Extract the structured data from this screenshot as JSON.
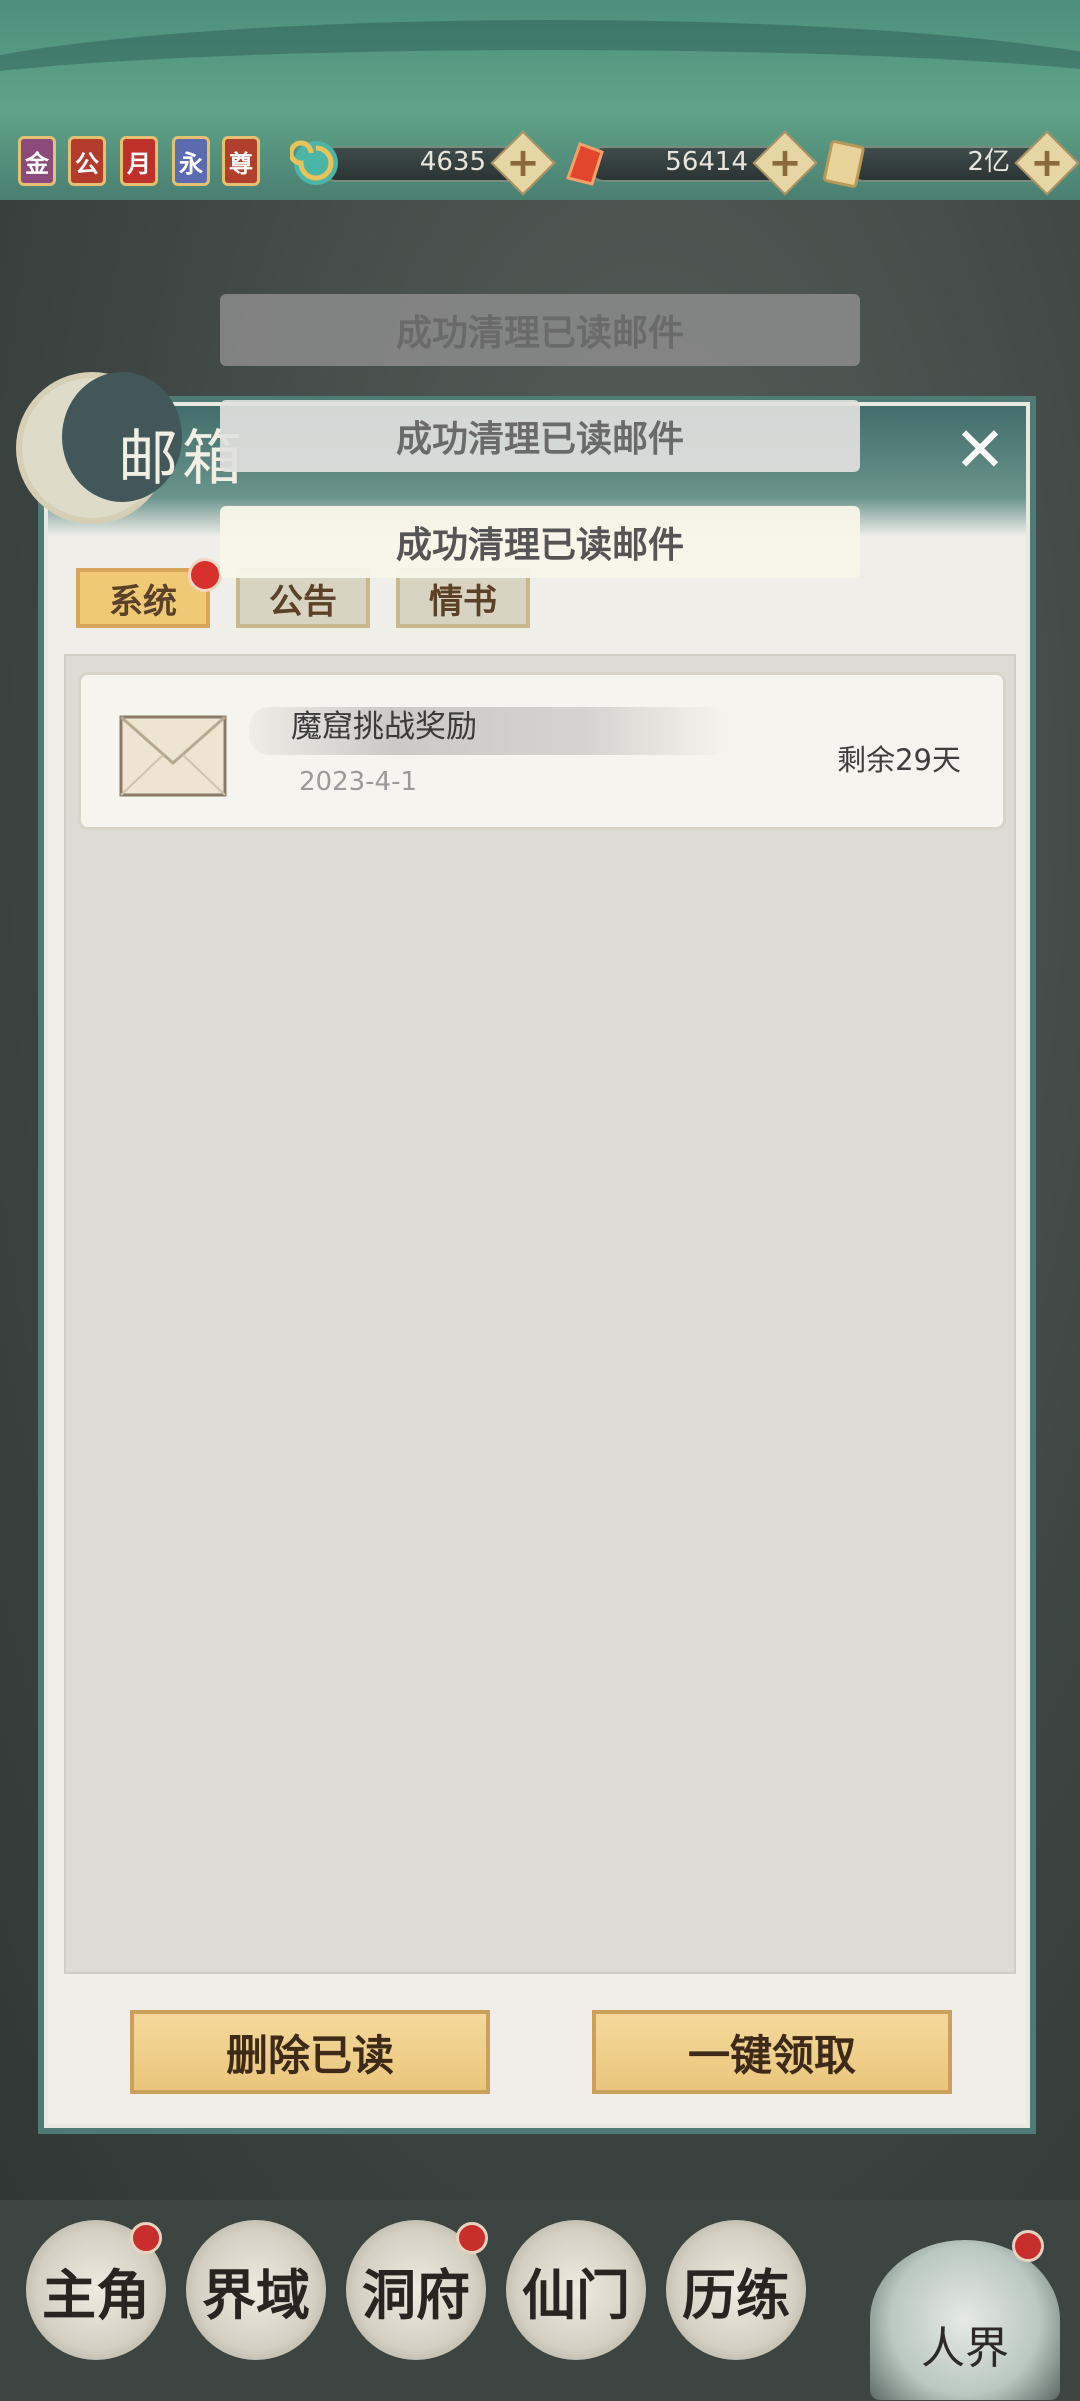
{
  "topbar": {
    "badges": [
      "金",
      "公",
      "月",
      "永",
      "尊"
    ],
    "resources": [
      {
        "icon": "spiral-jade-icon",
        "value": "4635"
      },
      {
        "icon": "red-crystal-icon",
        "value": "56414"
      },
      {
        "icon": "scroll-icon",
        "value": "2亿"
      }
    ],
    "plus": "+"
  },
  "toasts": [
    "成功清理已读邮件",
    "成功清理已读邮件",
    "成功清理已读邮件"
  ],
  "mailbox": {
    "title": "邮箱",
    "close": "✕",
    "tabs": [
      {
        "label": "系统",
        "active": true,
        "has_dot": true
      },
      {
        "label": "公告",
        "active": false,
        "has_dot": false
      },
      {
        "label": "情书",
        "active": false,
        "has_dot": false
      }
    ],
    "mails": [
      {
        "subject": "魔窟挑战奖励",
        "date": "2023-4-1",
        "remaining": "剩余29天"
      }
    ],
    "buttons": {
      "delete_read": "删除已读",
      "claim_all": "一键领取"
    }
  },
  "nav": {
    "items": [
      "主角",
      "界域",
      "洞府",
      "仙门",
      "历练"
    ],
    "big": "人界"
  },
  "colors": {
    "accent_gold": "#eac67c",
    "panel": "#efeee8",
    "notify_red": "#d8302d",
    "teal": "#4f7a75"
  }
}
